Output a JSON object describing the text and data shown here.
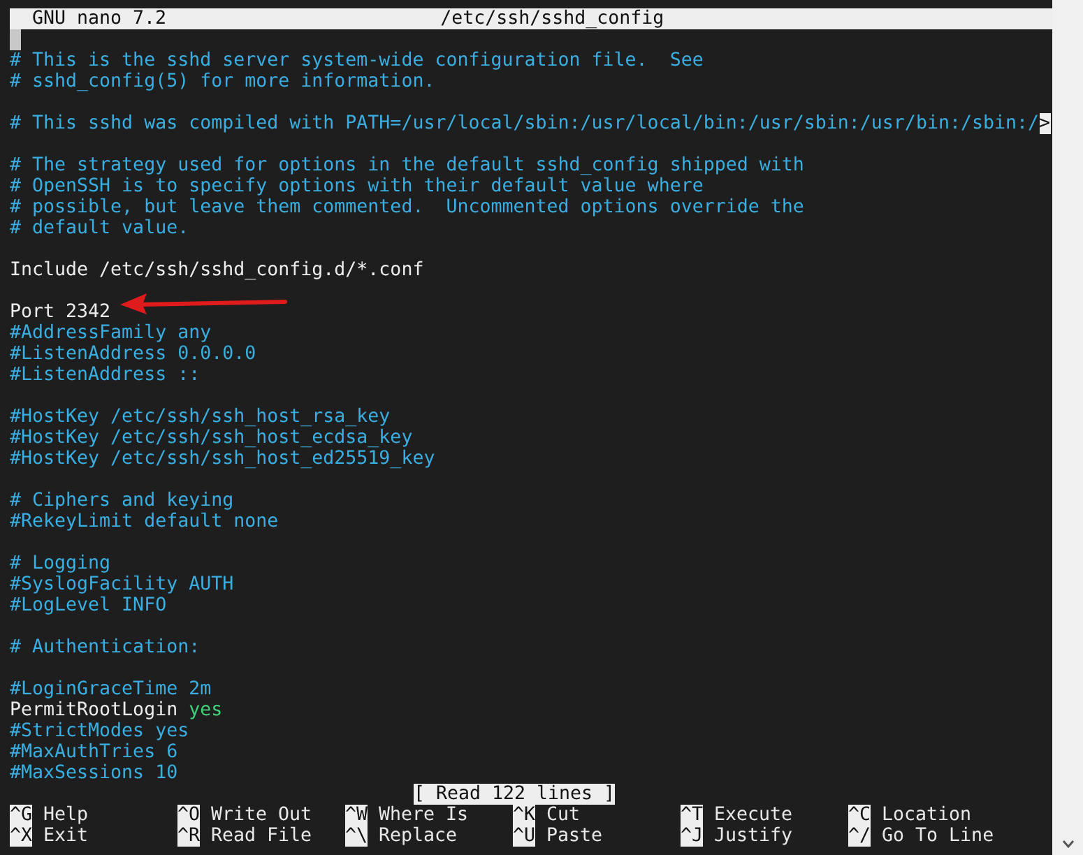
{
  "title_bar": {
    "app": "GNU nano 7.2",
    "file": "/etc/ssh/sshd_config"
  },
  "lines": [
    {
      "kind": "cursor"
    },
    {
      "kind": "text",
      "segments": [
        {
          "kind": "comment",
          "text": "# This is the sshd server system-wide configuration file.  See"
        }
      ]
    },
    {
      "kind": "text",
      "segments": [
        {
          "kind": "comment",
          "text": "# sshd_config(5) for more information."
        }
      ]
    },
    {
      "kind": "blank"
    },
    {
      "kind": "text",
      "segments": [
        {
          "kind": "comment",
          "text": "# This sshd was compiled with PATH=/usr/local/sbin:/usr/local/bin:/usr/sbin:/usr/bin:/sbin:/"
        }
      ],
      "overflow_marker": ">"
    },
    {
      "kind": "blank"
    },
    {
      "kind": "text",
      "segments": [
        {
          "kind": "comment",
          "text": "# The strategy used for options in the default sshd_config shipped with"
        }
      ]
    },
    {
      "kind": "text",
      "segments": [
        {
          "kind": "comment",
          "text": "# OpenSSH is to specify options with their default value where"
        }
      ]
    },
    {
      "kind": "text",
      "segments": [
        {
          "kind": "comment",
          "text": "# possible, but leave them commented.  Uncommented options override the"
        }
      ]
    },
    {
      "kind": "text",
      "segments": [
        {
          "kind": "comment",
          "text": "# default value."
        }
      ]
    },
    {
      "kind": "blank"
    },
    {
      "kind": "text",
      "segments": [
        {
          "kind": "directive",
          "text": "Include /etc/ssh/sshd_config.d/*.conf"
        }
      ]
    },
    {
      "kind": "blank"
    },
    {
      "kind": "text",
      "segments": [
        {
          "kind": "directive",
          "text": "Port 2342"
        }
      ],
      "annotated": true
    },
    {
      "kind": "text",
      "segments": [
        {
          "kind": "comment",
          "text": "#AddressFamily any"
        }
      ]
    },
    {
      "kind": "text",
      "segments": [
        {
          "kind": "comment",
          "text": "#ListenAddress 0.0.0.0"
        }
      ]
    },
    {
      "kind": "text",
      "segments": [
        {
          "kind": "comment",
          "text": "#ListenAddress ::"
        }
      ]
    },
    {
      "kind": "blank"
    },
    {
      "kind": "text",
      "segments": [
        {
          "kind": "comment",
          "text": "#HostKey /etc/ssh/ssh_host_rsa_key"
        }
      ]
    },
    {
      "kind": "text",
      "segments": [
        {
          "kind": "comment",
          "text": "#HostKey /etc/ssh/ssh_host_ecdsa_key"
        }
      ]
    },
    {
      "kind": "text",
      "segments": [
        {
          "kind": "comment",
          "text": "#HostKey /etc/ssh/ssh_host_ed25519_key"
        }
      ]
    },
    {
      "kind": "blank"
    },
    {
      "kind": "text",
      "segments": [
        {
          "kind": "comment",
          "text": "# Ciphers and keying"
        }
      ]
    },
    {
      "kind": "text",
      "segments": [
        {
          "kind": "comment",
          "text": "#RekeyLimit default none"
        }
      ]
    },
    {
      "kind": "blank"
    },
    {
      "kind": "text",
      "segments": [
        {
          "kind": "comment",
          "text": "# Logging"
        }
      ]
    },
    {
      "kind": "text",
      "segments": [
        {
          "kind": "comment",
          "text": "#SyslogFacility AUTH"
        }
      ]
    },
    {
      "kind": "text",
      "segments": [
        {
          "kind": "comment",
          "text": "#LogLevel INFO"
        }
      ]
    },
    {
      "kind": "blank"
    },
    {
      "kind": "text",
      "segments": [
        {
          "kind": "comment",
          "text": "# Authentication:"
        }
      ]
    },
    {
      "kind": "blank"
    },
    {
      "kind": "text",
      "segments": [
        {
          "kind": "comment",
          "text": "#LoginGraceTime 2m"
        }
      ]
    },
    {
      "kind": "text",
      "segments": [
        {
          "kind": "directive",
          "text": "PermitRootLogin"
        },
        {
          "kind": "value",
          "text": "yes"
        }
      ]
    },
    {
      "kind": "text",
      "segments": [
        {
          "kind": "comment",
          "text": "#StrictModes yes"
        }
      ]
    },
    {
      "kind": "text",
      "segments": [
        {
          "kind": "comment",
          "text": "#MaxAuthTries 6"
        }
      ]
    },
    {
      "kind": "text",
      "segments": [
        {
          "kind": "comment",
          "text": "#MaxSessions 10"
        }
      ]
    }
  ],
  "status": "[ Read 122 lines ]",
  "shortcuts": [
    {
      "key": "^G",
      "label": "Help"
    },
    {
      "key": "^O",
      "label": "Write Out"
    },
    {
      "key": "^W",
      "label": "Where Is"
    },
    {
      "key": "^K",
      "label": "Cut"
    },
    {
      "key": "^T",
      "label": "Execute"
    },
    {
      "key": "^C",
      "label": "Location"
    },
    {
      "key": "^X",
      "label": "Exit"
    },
    {
      "key": "^R",
      "label": "Read File"
    },
    {
      "key": "^\\",
      "label": "Replace"
    },
    {
      "key": "^U",
      "label": "Paste"
    },
    {
      "key": "^J",
      "label": "Justify"
    },
    {
      "key": "^/",
      "label": "Go To Line"
    }
  ]
}
